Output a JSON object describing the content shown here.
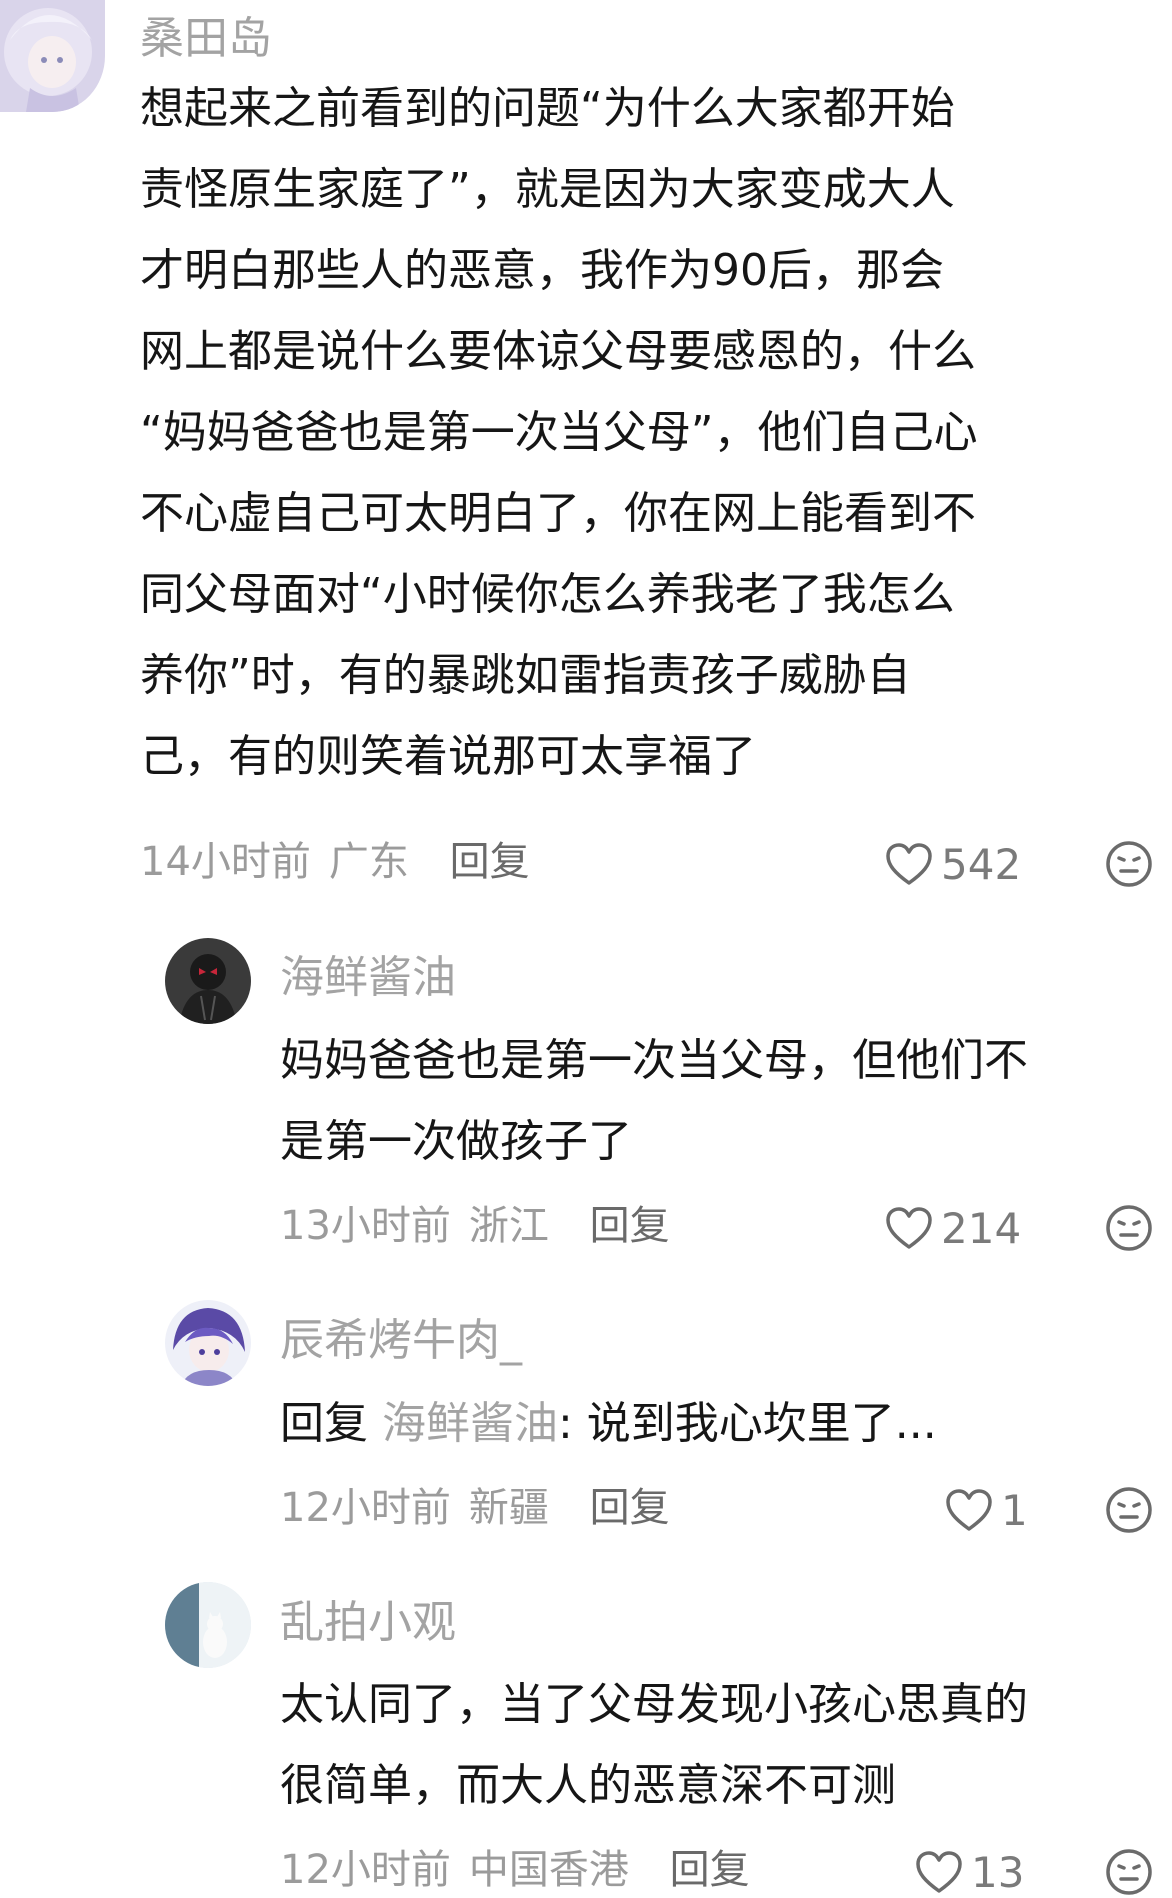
{
  "comments": [
    {
      "username": "桑田岛",
      "lines": [
        "想起来之前看到的问题“为什么大家都开始",
        "责怪原生家庭了”，就是因为大家变成大人",
        "才明白那些人的恶意，我作为90后，那会",
        "网上都是说什么要体谅父母要感恩的，什么",
        "“妈妈爸爸也是第一次当父母”，他们自己心",
        "不心虚自己可太明白了，你在网上能看到不",
        "同父母面对“小时候你怎么养我老了我怎么",
        "养你”时，有的暴跳如雷指责孩子威胁自",
        "己，有的则笑着说那可太享福了"
      ],
      "time": "14小时前",
      "location": "广东",
      "reply_label": "回复",
      "likes": "542",
      "avatar_icon": "anime-girl-avatar"
    },
    {
      "username": "海鲜酱油",
      "lines": [
        "妈妈爸爸也是第一次当父母，但他们不",
        "是第一次做孩子了"
      ],
      "time": "13小时前",
      "location": "浙江",
      "reply_label": "回复",
      "likes": "214",
      "avatar_icon": "dark-masked-figure-avatar"
    },
    {
      "username": "辰希烤牛肉_",
      "reply_prefix": "回复",
      "reply_target": "海鲜酱油",
      "lines": [
        ": 说到我心坎里了..."
      ],
      "time": "12小时前",
      "location": "新疆",
      "reply_label": "回复",
      "likes": "1",
      "avatar_icon": "anime-purple-hair-avatar"
    },
    {
      "username": "乱拍小观",
      "lines": [
        "太认同了，当了父母发现小孩心思真的",
        "很简单，而大人的恶意深不可测"
      ],
      "time": "12小时前",
      "location": "中国香港",
      "reply_label": "回复",
      "likes": "13",
      "avatar_icon": "window-cat-avatar"
    }
  ],
  "colors": {
    "username": "#a3a3a3",
    "text": "#161616",
    "meta": "#9b9b9b"
  }
}
